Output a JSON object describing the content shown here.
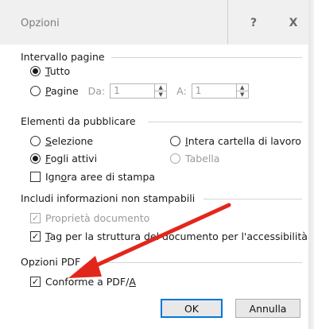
{
  "window": {
    "title": "Opzioni",
    "help_label": "?",
    "close_label": "X"
  },
  "range": {
    "heading": "Intervallo pagine",
    "all": {
      "pre": "",
      "key": "T",
      "post": "utto",
      "selected": true
    },
    "pages": {
      "pre": "",
      "key": "P",
      "post": "agine",
      "selected": false
    },
    "from_label": "Da:",
    "from_value": "1",
    "to_label": "A:",
    "to_value": "1"
  },
  "publish": {
    "heading": "Elementi da pubblicare",
    "selection": {
      "pre": "",
      "key": "S",
      "post": "elezione",
      "selected": false
    },
    "workbook": {
      "pre": "",
      "key": "I",
      "post": "ntera cartella di lavoro",
      "selected": false
    },
    "active_sheets": {
      "pre": "",
      "key": "F",
      "post": "ogli attivi",
      "selected": true
    },
    "table": {
      "label": "Tabella",
      "selected": false,
      "disabled": true
    },
    "ignore_print_areas": {
      "pre": "Ign",
      "key": "o",
      "post": "ra aree di stampa",
      "checked": false
    }
  },
  "nonprint": {
    "heading": "Includi informazioni non stampabili",
    "doc_props": {
      "label": "Proprietà documento",
      "checked": true,
      "disabled": true
    },
    "tags": {
      "pre": "",
      "key": "T",
      "post": "ag per la struttura del documento per l'accessibilità",
      "checked": true
    }
  },
  "pdf": {
    "heading": "Opzioni PDF",
    "pdfa": {
      "pre": "Conforme a PDF/",
      "key": "A",
      "post": "",
      "checked": true
    }
  },
  "buttons": {
    "ok": "OK",
    "cancel": "Annulla"
  },
  "colors": {
    "annotation_arrow": "#e3261c",
    "title_bar": "#f0f0f0",
    "focus_border": "#0078d7"
  }
}
